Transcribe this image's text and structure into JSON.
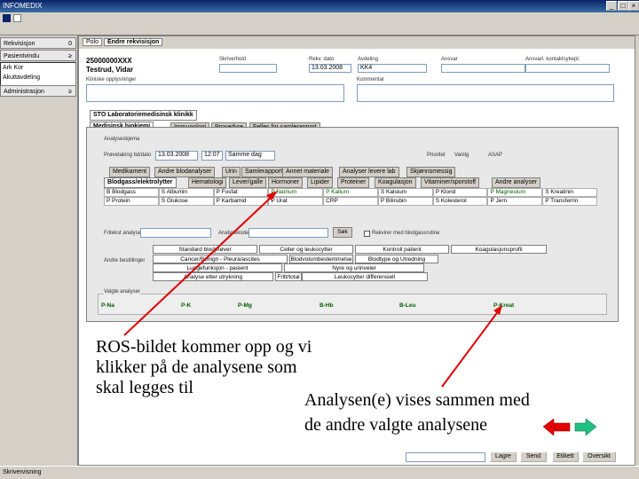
{
  "window": {
    "title": "INFOMEDIX",
    "minimize": "_",
    "restore": "□",
    "close": "×"
  },
  "sidebar": {
    "header1": "Rekvisisjon",
    "header1_badge": "0",
    "header2": "Pasientvindu",
    "header2_badge": "≥",
    "items": [
      "Ark Kor",
      "Akuttavdeling"
    ],
    "header3": "Administrasjon",
    "header3_badge": "≥"
  },
  "form": {
    "tabs": [
      "Polo",
      "Endre rekvisisjon"
    ],
    "patient_id": "25000000XXX",
    "patient_name": "Testrud, Vidar",
    "labels": {
      "field1": "Skriverhold",
      "field2": "Rekv. dato",
      "field3": "Avdeling",
      "field4": "Ansvar",
      "field5": "Ansvarl. kontaktsykepl.",
      "kliniske": "Kliniske opplysninger",
      "kommentar": "Kommentar"
    },
    "values": {
      "rekv_dato": "13.03.2008",
      "avdeling": "KK4"
    },
    "subtitle": "STO Laboratoriemedisinsk klinikk",
    "subtabs": [
      "Medisinsk biokjemi",
      "Immunologi",
      "Prosedyre",
      "Felles for samlerapport"
    ],
    "analyse_label": "Analyseskjema",
    "tatt_label": "Prøvetaking tid/dato",
    "tatt_date": "13.03.2008",
    "tatt_time": "12:07",
    "tatt_combo": "Samme dag",
    "prioritet_label": "Prioritet",
    "prioritet_normal": "Vanlig",
    "prioritet_ohjelp": "ASAP"
  },
  "panel_tabs": [
    "Medikament",
    "Andre blodanalyser",
    "Urin",
    "Samlerapport",
    "Annet materiale",
    "Analyser levere lab",
    "Skjønnsmessig"
  ],
  "panel_tabs2": [
    "Blodgass/elektrolytter",
    "Hematologi",
    "Lever/galle",
    "Hormoner",
    "Lipider",
    "Proteiner",
    "Koagulasjon",
    "Vitaminer/sporstoff",
    "Andre analyser"
  ],
  "grid": [
    [
      "B Blodgass",
      "S Albumin",
      "P Fosfat",
      "P Natrium",
      "P Kalium",
      "S Kalsium",
      "P Klorid",
      "P Magnesium",
      "S Kreatinin"
    ],
    [
      "P Protein",
      "S Glukose",
      "P Karbamid",
      "P Urat",
      "CRP",
      "P Bilirubin",
      "S Kolesterol",
      "P Jern",
      "P Transferrin"
    ]
  ],
  "fritekst_label": "Fritekst analyse",
  "fritekst_btn_label": "Analysekode",
  "sok_label": "Søk",
  "checkbox_label": "Rekvirer med blodgassrutine",
  "andre_label": "Andre bestillinger",
  "buttons": [
    "Standard blodprøver",
    "Celler og leukocytter",
    "Kontroll patient",
    "Koagulasjonsprofil",
    "Cancer/Benign - Pleura/ascites",
    "Blodvolumbestemmelse",
    "Blodtype og Utredning",
    "Lungefunksjon - pasient",
    "Nyre og urinveier",
    "Analyse etter utrykning",
    "Fritt/total",
    "Leukocytter differensiell"
  ],
  "valgte_label": "Valgte analyser",
  "valgte": [
    "P-Na",
    "P-K",
    "P-Mg",
    "B-Hb",
    "B-Leu",
    "P-Kreat"
  ],
  "overlay": {
    "line1": "ROS-bildet kommer opp og vi",
    "line2": "klikker på de analysene som",
    "line3": "skal legges til",
    "right1": "Analysen(e) vises sammen med",
    "right2": "de andre valgte analysene"
  },
  "status": {
    "left": "Skrivervisning",
    "lagre": "Lagre",
    "send": "Send",
    "etikett": "Etikett",
    "oversikt": "Oversikt"
  }
}
